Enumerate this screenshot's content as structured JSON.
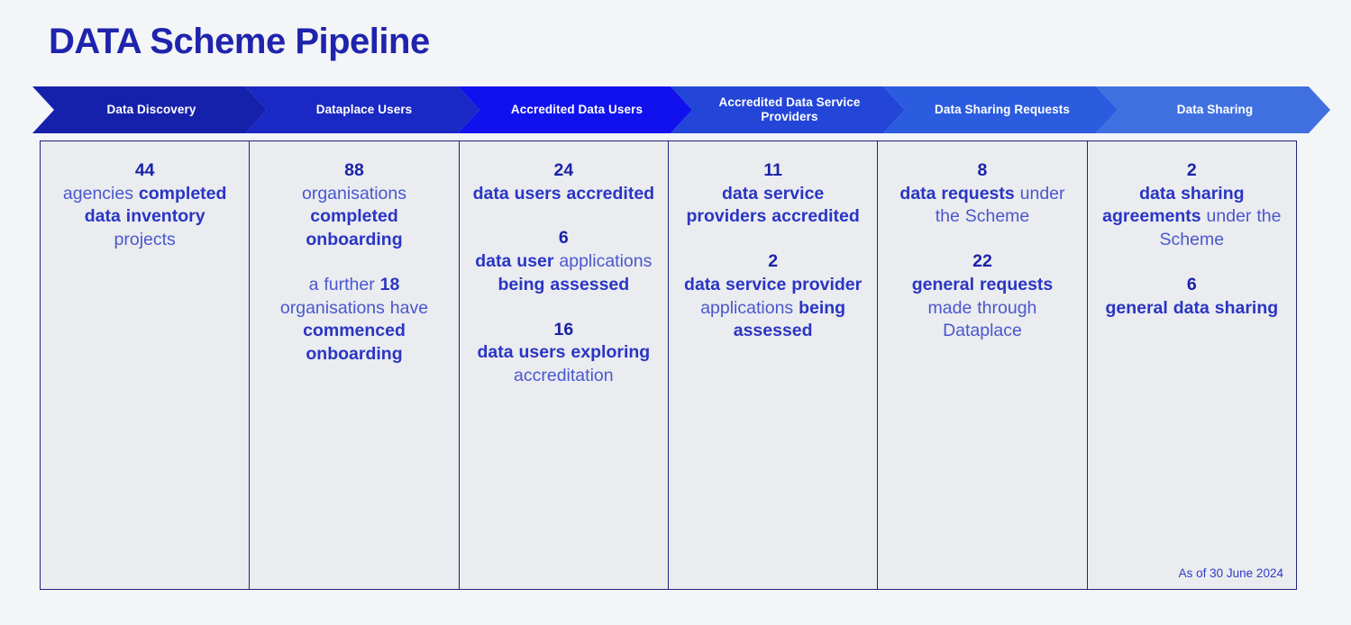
{
  "title": "DATA Scheme Pipeline",
  "theme": {
    "title_color": "#1f24ad",
    "panel_bg": "#eaecef",
    "panel_border": "#1f2380",
    "page_bg": "#f4f5f7",
    "text_bold": "#1a22a8",
    "text_light": "#4a57cf"
  },
  "stages": [
    {
      "label": "Data Discovery",
      "color": "#1621ab",
      "paragraphs": [
        {
          "number": "44",
          "segments": [
            {
              "text": "agencies ",
              "bold": false
            },
            {
              "text": "completed data inventory ",
              "bold": true
            },
            {
              "text": "projects",
              "bold": false
            }
          ]
        }
      ]
    },
    {
      "label": "Dataplace Users",
      "color": "#1a28c4",
      "paragraphs": [
        {
          "number": "88",
          "segments": [
            {
              "text": "organisations ",
              "bold": false
            },
            {
              "text": "completed onboarding",
              "bold": true
            }
          ]
        },
        {
          "number": "",
          "segments": [
            {
              "text": "a further ",
              "bold": false
            },
            {
              "text": "18 ",
              "bold": true
            },
            {
              "text": "organisations have ",
              "bold": false
            },
            {
              "text": "commenced onboarding",
              "bold": true
            }
          ]
        }
      ]
    },
    {
      "label": "Accredited Data Users",
      "color": "#1111ee",
      "paragraphs": [
        {
          "number": "24",
          "segments": [
            {
              "text": "data users accredited",
              "bold": true
            }
          ]
        },
        {
          "number": "6",
          "segments": [
            {
              "text": "data user ",
              "bold": true
            },
            {
              "text": "applications ",
              "bold": false
            },
            {
              "text": "being assessed",
              "bold": true
            }
          ]
        },
        {
          "number": "16",
          "segments": [
            {
              "text": "data users exploring ",
              "bold": true
            },
            {
              "text": "accreditation",
              "bold": false
            }
          ]
        }
      ]
    },
    {
      "label": "Accredited Data Service Providers",
      "color": "#2346d8",
      "paragraphs": [
        {
          "number": "11",
          "segments": [
            {
              "text": "data service providers accredited",
              "bold": true
            }
          ]
        },
        {
          "number": "2",
          "segments": [
            {
              "text": "data service provider ",
              "bold": true
            },
            {
              "text": "applications ",
              "bold": false
            },
            {
              "text": "being assessed",
              "bold": true
            }
          ]
        }
      ]
    },
    {
      "label": "Data Sharing Requests",
      "color": "#2b5ce0",
      "paragraphs": [
        {
          "number": "8",
          "segments": [
            {
              "text": "data requests ",
              "bold": true
            },
            {
              "text": "under the Scheme",
              "bold": false
            }
          ]
        },
        {
          "number": "22",
          "segments": [
            {
              "text": "general requests ",
              "bold": true
            },
            {
              "text": "made through Dataplace",
              "bold": false
            }
          ]
        }
      ]
    },
    {
      "label": "Data Sharing",
      "color": "#4070e0",
      "paragraphs": [
        {
          "number": "2",
          "segments": [
            {
              "text": "data sharing agreements ",
              "bold": true
            },
            {
              "text": "under the Scheme",
              "bold": false
            }
          ]
        },
        {
          "number": "6",
          "segments": [
            {
              "text": "general data sharing",
              "bold": true
            }
          ]
        }
      ]
    }
  ],
  "footnote": "As of 30 June 2024"
}
